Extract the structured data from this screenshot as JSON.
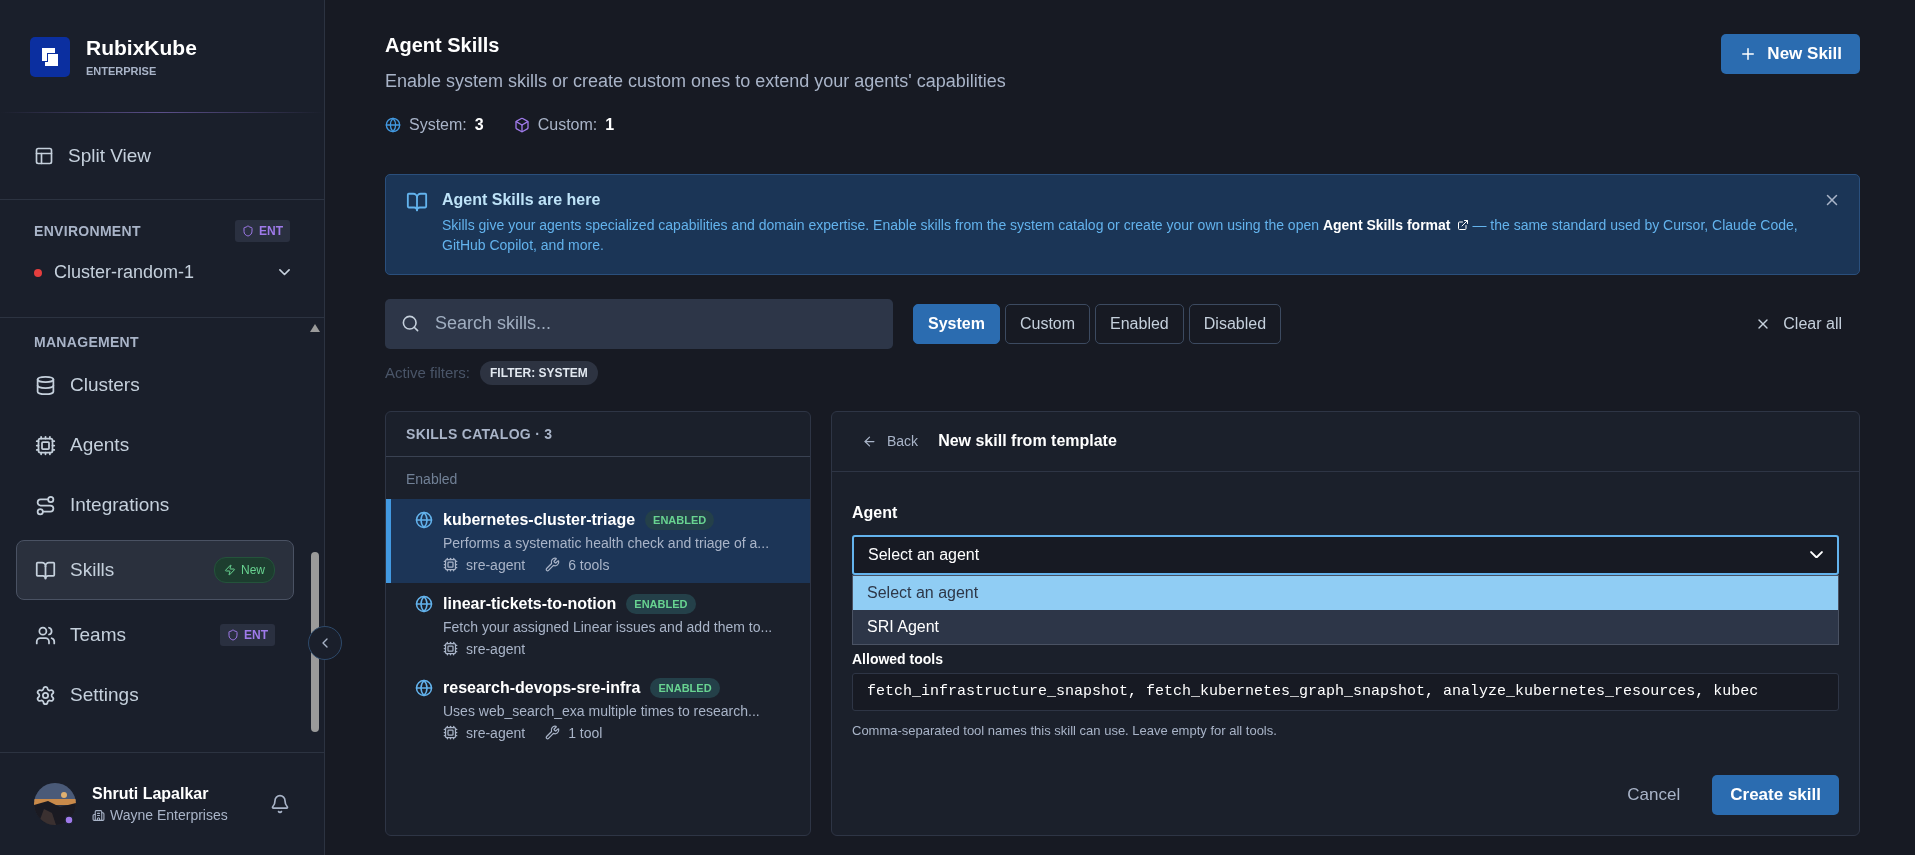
{
  "sidebar": {
    "brand": {
      "name": "RubixKube",
      "edition": "ENTERPRISE"
    },
    "split_view": "Split View",
    "environment": {
      "label": "ENVIRONMENT",
      "badge": "ENT",
      "cluster": {
        "name": "Cluster-random-1",
        "color": "#e53e3e"
      }
    },
    "management": {
      "label": "MANAGEMENT",
      "items": [
        {
          "label": "Clusters",
          "selected": false
        },
        {
          "label": "Agents",
          "selected": false
        },
        {
          "label": "Integrations",
          "selected": false
        },
        {
          "label": "Skills",
          "selected": true,
          "badge": {
            "kind": "new",
            "text": "New"
          }
        },
        {
          "label": "Teams",
          "selected": false,
          "badge": {
            "kind": "ent",
            "text": "ENT"
          }
        },
        {
          "label": "Settings",
          "selected": false
        }
      ]
    },
    "user": {
      "name": "Shruti Lapalkar",
      "org": "Wayne Enterprises"
    }
  },
  "header": {
    "title": "Agent Skills",
    "subtitle": "Enable system skills or create custom ones to extend your agents' capabilities",
    "new_button": "New Skill",
    "counts": [
      {
        "kind": "system",
        "label": "System:",
        "value": "3"
      },
      {
        "kind": "custom",
        "label": "Custom:",
        "value": "1"
      }
    ]
  },
  "banner": {
    "title": "Agent Skills are here",
    "text_before": "Skills give your agents specialized capabilities and domain expertise. Enable skills from the system catalog or create your own using the open ",
    "link": "Agent Skills format",
    "text_after": " — the same standard used by Cursor, Claude Code, GitHub Copilot, and more."
  },
  "search": {
    "placeholder": "Search skills..."
  },
  "filters": [
    {
      "label": "System",
      "selected": true
    },
    {
      "label": "Custom",
      "selected": false
    },
    {
      "label": "Enabled",
      "selected": false
    },
    {
      "label": "Disabled",
      "selected": false
    }
  ],
  "clear_all": "Clear all",
  "active_filters": {
    "label": "Active filters:",
    "chips": [
      "FILTER: SYSTEM"
    ]
  },
  "catalog": {
    "title": "SKILLS CATALOG · 3",
    "group": "Enabled",
    "items": [
      {
        "name": "kubernetes-cluster-triage",
        "status": "ENABLED",
        "description": "Performs a systematic health check and triage of a...",
        "agent": "sre-agent",
        "tools": "6 tools",
        "selected": true
      },
      {
        "name": "linear-tickets-to-notion",
        "status": "ENABLED",
        "description": "Fetch your assigned Linear issues and add them to...",
        "agent": "sre-agent",
        "selected": false
      },
      {
        "name": "research-devops-sre-infra",
        "status": "ENABLED",
        "description": "Uses web_search_exa multiple times to research...",
        "agent": "sre-agent",
        "tools": "1 tool",
        "selected": false
      }
    ]
  },
  "detail": {
    "back": "Back",
    "title": "New skill from template",
    "agent_label": "Agent",
    "agent_value": "Select an agent",
    "agent_options": [
      {
        "label": "Select an agent",
        "selected": true
      },
      {
        "label": "SRI Agent",
        "selected": false
      }
    ],
    "tools_label": "Allowed tools",
    "tools_value": "fetch_infrastructure_snapshot, fetch_kubernetes_graph_snapshot, analyze_kubernetes_resources, kubec",
    "tools_hint": "Comma-separated tool names this skill can use. Leave empty for all tools.",
    "cancel": "Cancel",
    "create": "Create skill"
  }
}
